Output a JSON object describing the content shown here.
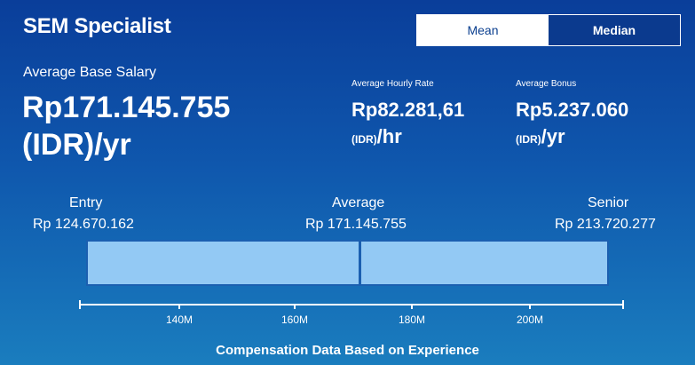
{
  "header": {
    "title": "SEM Specialist",
    "toggle": {
      "mean_label": "Mean",
      "median_label": "Median",
      "selected": "Mean"
    }
  },
  "base_salary": {
    "label": "Average Base Salary",
    "amount": "Rp171.145.755",
    "unit": "(IDR)/yr"
  },
  "hourly_rate": {
    "label": "Average Hourly Rate",
    "amount": "Rp82.281,61",
    "currency": "(IDR)",
    "period": "/hr"
  },
  "bonus": {
    "label": "Average Bonus",
    "amount": "Rp5.237.060",
    "currency": "(IDR)",
    "period": "/yr"
  },
  "range": {
    "entry_label": "Entry",
    "entry_value": "Rp 124.670.162",
    "average_label": "Average",
    "average_value": "Rp 171.145.755",
    "senior_label": "Senior",
    "senior_value": "Rp 213.720.277"
  },
  "axis": {
    "ticks": [
      "140M",
      "160M",
      "180M",
      "200M"
    ]
  },
  "footer": "Compensation Data Based on Experience",
  "colors": {
    "background_top": "#0a3e9a",
    "background_bottom": "#1a7dbe",
    "bar_fill": "#93c9f4",
    "bar_border": "#1b5fb0"
  }
}
